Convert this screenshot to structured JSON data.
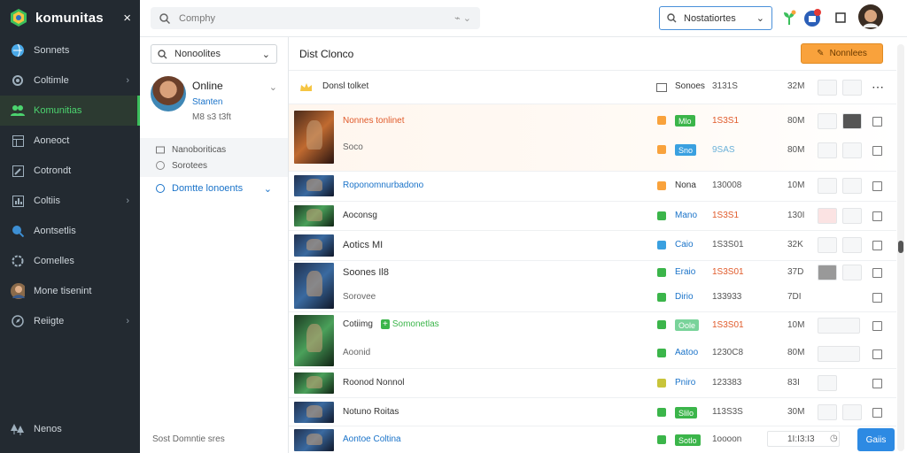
{
  "brand": {
    "name": "komunitas",
    "close": "×"
  },
  "sidebar": {
    "items": [
      {
        "label": "Sonnets",
        "icon": "globe-icon",
        "chev": ""
      },
      {
        "label": "Coltimle",
        "icon": "gear-icon",
        "chev": "›"
      },
      {
        "label": "Komunitias",
        "icon": "people-icon",
        "chev": "",
        "active": true
      },
      {
        "label": "Aoneoct",
        "icon": "grid-icon",
        "chev": ""
      },
      {
        "label": "Cotrondt",
        "icon": "edit-icon",
        "chev": ""
      },
      {
        "label": "Coltiis",
        "icon": "chart-icon",
        "chev": "›"
      },
      {
        "label": "Aontsetlis",
        "icon": "search-icon",
        "chev": ""
      },
      {
        "label": "Comelles",
        "icon": "settings-icon",
        "chev": ""
      },
      {
        "label": "Mone tisenint",
        "icon": "user-avatar-icon",
        "chev": ""
      },
      {
        "label": "Reiigte",
        "icon": "compass-icon",
        "chev": "›"
      }
    ],
    "bottom": {
      "label": "Nenos",
      "icon": "trees-icon"
    }
  },
  "topbar": {
    "search_placeholder": "Comphy",
    "search_tools": "⌁ ⌄",
    "dropdown_value": "Nostatiortes"
  },
  "col2": {
    "select_value": "Nonoolites",
    "profile": {
      "name": "Online",
      "status": "Stanten",
      "meta": "M8 s3 t3ft"
    },
    "subitems": [
      "Nanoboriticas",
      "Sorotees"
    ],
    "link_item": "Domtte lonoents",
    "footer": "Sost Domntie sres"
  },
  "main": {
    "title": "Dist Clonco",
    "action_button": "Nonnlees",
    "header_row": {
      "label": "Donsl tolket",
      "col1": "Sonoes",
      "col2": "3131S",
      "size": "32M"
    },
    "rows": [
      {
        "title": "Nonnes tonlinet",
        "sub": "Soco",
        "tag1": "Mlo",
        "tag1c": "#3bb54a",
        "n1": "1S3S1",
        "size1": "80M",
        "tag2": "Sno",
        "tag2c": "#3aa0e0",
        "n2": "9SAS",
        "size2": "80M",
        "thumb": "r"
      },
      {
        "title": "Roponomnurbadono",
        "tag1": "Nona",
        "tag1c": "",
        "n1": "130008",
        "size1": "10M",
        "thumb": "b"
      },
      {
        "title": "Aoconsg",
        "tag1": "Mano",
        "tag1c": "",
        "n1": "1S3S1",
        "size1": "130I",
        "thumb": "g"
      },
      {
        "title": "Aotics MI",
        "tag1": "Caio",
        "tag1c": "",
        "n1": "1S3S01",
        "size1": "32K",
        "thumb": "b"
      },
      {
        "title": "Soones Il8",
        "sub": "Sorovee",
        "tag1": "Eraio",
        "tag1c": "",
        "n1": "1S3S01",
        "size1": "37D",
        "tag2": "Dirio",
        "tag2c": "",
        "n2": "133933",
        "size2": "7DI",
        "thumb": "b"
      },
      {
        "title": "Cotiimg",
        "badge": "Somonetlas",
        "sub": "Aoonid",
        "tag1": "Oole",
        "tag1c": "#79d39a",
        "n1": "1S3S01",
        "size1": "10M",
        "tag2": "Aatoo",
        "tag2c": "",
        "n2": "1230C8",
        "size2": "80M",
        "thumb": "g"
      },
      {
        "title": "Roonod Nonnol",
        "tag1": "Pniro",
        "tag1c": "",
        "n1": "123383",
        "size1": "83I",
        "thumb": "g"
      },
      {
        "title": "Notuno Roitas",
        "tag1": "Slilo",
        "tag1c": "#3bb54a",
        "n1": "113S3S",
        "size1": "30M",
        "thumb": "b"
      },
      {
        "title": "Aontoe Coltina",
        "tag1": "Sotlo",
        "tag1c": "#3bb54a",
        "n1": "1oooon",
        "size1": "1I:I3:I3",
        "thumb": "b"
      }
    ],
    "add_button": "Gaiis"
  },
  "colors": {
    "sidebar_bg": "#232a31",
    "accent_green": "#3bbf5c",
    "accent_orange": "#f9a23c",
    "link_blue": "#1a73c9"
  }
}
